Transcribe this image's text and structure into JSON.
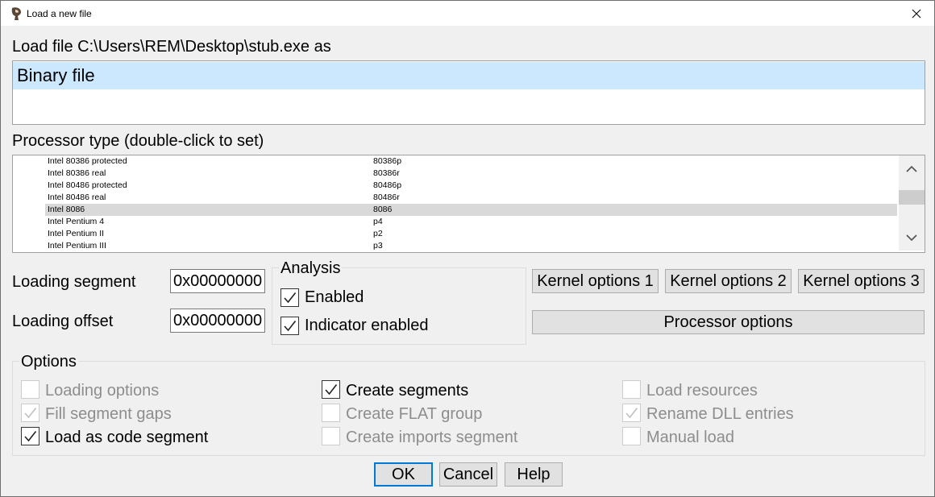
{
  "window": {
    "title": "Load a new file"
  },
  "load_file_label": "Load file C:\\Users\\REM\\Desktop\\stub.exe as",
  "file_types": [
    "Binary file"
  ],
  "processor": {
    "label": "Processor type (double-click to set)",
    "rows": [
      {
        "name": "Intel 80386 protected",
        "code": "80386p"
      },
      {
        "name": "Intel 80386 real",
        "code": "80386r"
      },
      {
        "name": "Intel 80486 protected",
        "code": "80486p"
      },
      {
        "name": "Intel 80486 real",
        "code": "80486r"
      },
      {
        "name": "Intel 8086",
        "code": "8086",
        "selected": true
      },
      {
        "name": "Intel Pentium 4",
        "code": "p4"
      },
      {
        "name": "Intel Pentium II",
        "code": "p2"
      },
      {
        "name": "Intel Pentium III",
        "code": "p3"
      }
    ]
  },
  "loading": {
    "segment_label": "Loading segment",
    "segment_value": "0x00000000",
    "offset_label": "Loading offset",
    "offset_value": "0x00000000"
  },
  "analysis": {
    "title": "Analysis",
    "enabled_label": "Enabled",
    "enabled_checked": true,
    "indicator_label": "Indicator enabled",
    "indicator_checked": true
  },
  "buttons": {
    "kernel1": "Kernel options 1",
    "kernel2": "Kernel options 2",
    "kernel3": "Kernel options 3",
    "processor_options": "Processor options",
    "ok": "OK",
    "cancel": "Cancel",
    "help": "Help"
  },
  "options": {
    "title": "Options",
    "loading_options": "Loading options",
    "fill_segment_gaps": "Fill segment gaps",
    "load_as_code_segment": "Load as code segment",
    "create_segments": "Create segments",
    "create_flat_group": "Create FLAT group",
    "create_imports_segment": "Create imports segment",
    "load_resources": "Load resources",
    "rename_dll_entries": "Rename DLL entries",
    "manual_load": "Manual load"
  }
}
